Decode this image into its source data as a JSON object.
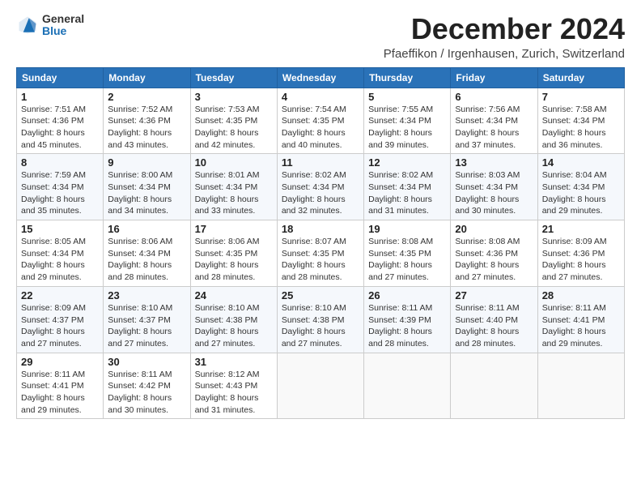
{
  "logo": {
    "general": "General",
    "blue": "Blue"
  },
  "title": "December 2024",
  "location": "Pfaeffikon / Irgenhausen, Zurich, Switzerland",
  "headers": [
    "Sunday",
    "Monday",
    "Tuesday",
    "Wednesday",
    "Thursday",
    "Friday",
    "Saturday"
  ],
  "weeks": [
    [
      {
        "day": "1",
        "info": "Sunrise: 7:51 AM\nSunset: 4:36 PM\nDaylight: 8 hours\nand 45 minutes."
      },
      {
        "day": "2",
        "info": "Sunrise: 7:52 AM\nSunset: 4:36 PM\nDaylight: 8 hours\nand 43 minutes."
      },
      {
        "day": "3",
        "info": "Sunrise: 7:53 AM\nSunset: 4:35 PM\nDaylight: 8 hours\nand 42 minutes."
      },
      {
        "day": "4",
        "info": "Sunrise: 7:54 AM\nSunset: 4:35 PM\nDaylight: 8 hours\nand 40 minutes."
      },
      {
        "day": "5",
        "info": "Sunrise: 7:55 AM\nSunset: 4:34 PM\nDaylight: 8 hours\nand 39 minutes."
      },
      {
        "day": "6",
        "info": "Sunrise: 7:56 AM\nSunset: 4:34 PM\nDaylight: 8 hours\nand 37 minutes."
      },
      {
        "day": "7",
        "info": "Sunrise: 7:58 AM\nSunset: 4:34 PM\nDaylight: 8 hours\nand 36 minutes."
      }
    ],
    [
      {
        "day": "8",
        "info": "Sunrise: 7:59 AM\nSunset: 4:34 PM\nDaylight: 8 hours\nand 35 minutes."
      },
      {
        "day": "9",
        "info": "Sunrise: 8:00 AM\nSunset: 4:34 PM\nDaylight: 8 hours\nand 34 minutes."
      },
      {
        "day": "10",
        "info": "Sunrise: 8:01 AM\nSunset: 4:34 PM\nDaylight: 8 hours\nand 33 minutes."
      },
      {
        "day": "11",
        "info": "Sunrise: 8:02 AM\nSunset: 4:34 PM\nDaylight: 8 hours\nand 32 minutes."
      },
      {
        "day": "12",
        "info": "Sunrise: 8:02 AM\nSunset: 4:34 PM\nDaylight: 8 hours\nand 31 minutes."
      },
      {
        "day": "13",
        "info": "Sunrise: 8:03 AM\nSunset: 4:34 PM\nDaylight: 8 hours\nand 30 minutes."
      },
      {
        "day": "14",
        "info": "Sunrise: 8:04 AM\nSunset: 4:34 PM\nDaylight: 8 hours\nand 29 minutes."
      }
    ],
    [
      {
        "day": "15",
        "info": "Sunrise: 8:05 AM\nSunset: 4:34 PM\nDaylight: 8 hours\nand 29 minutes."
      },
      {
        "day": "16",
        "info": "Sunrise: 8:06 AM\nSunset: 4:34 PM\nDaylight: 8 hours\nand 28 minutes."
      },
      {
        "day": "17",
        "info": "Sunrise: 8:06 AM\nSunset: 4:35 PM\nDaylight: 8 hours\nand 28 minutes."
      },
      {
        "day": "18",
        "info": "Sunrise: 8:07 AM\nSunset: 4:35 PM\nDaylight: 8 hours\nand 28 minutes."
      },
      {
        "day": "19",
        "info": "Sunrise: 8:08 AM\nSunset: 4:35 PM\nDaylight: 8 hours\nand 27 minutes."
      },
      {
        "day": "20",
        "info": "Sunrise: 8:08 AM\nSunset: 4:36 PM\nDaylight: 8 hours\nand 27 minutes."
      },
      {
        "day": "21",
        "info": "Sunrise: 8:09 AM\nSunset: 4:36 PM\nDaylight: 8 hours\nand 27 minutes."
      }
    ],
    [
      {
        "day": "22",
        "info": "Sunrise: 8:09 AM\nSunset: 4:37 PM\nDaylight: 8 hours\nand 27 minutes."
      },
      {
        "day": "23",
        "info": "Sunrise: 8:10 AM\nSunset: 4:37 PM\nDaylight: 8 hours\nand 27 minutes."
      },
      {
        "day": "24",
        "info": "Sunrise: 8:10 AM\nSunset: 4:38 PM\nDaylight: 8 hours\nand 27 minutes."
      },
      {
        "day": "25",
        "info": "Sunrise: 8:10 AM\nSunset: 4:38 PM\nDaylight: 8 hours\nand 27 minutes."
      },
      {
        "day": "26",
        "info": "Sunrise: 8:11 AM\nSunset: 4:39 PM\nDaylight: 8 hours\nand 28 minutes."
      },
      {
        "day": "27",
        "info": "Sunrise: 8:11 AM\nSunset: 4:40 PM\nDaylight: 8 hours\nand 28 minutes."
      },
      {
        "day": "28",
        "info": "Sunrise: 8:11 AM\nSunset: 4:41 PM\nDaylight: 8 hours\nand 29 minutes."
      }
    ],
    [
      {
        "day": "29",
        "info": "Sunrise: 8:11 AM\nSunset: 4:41 PM\nDaylight: 8 hours\nand 29 minutes."
      },
      {
        "day": "30",
        "info": "Sunrise: 8:11 AM\nSunset: 4:42 PM\nDaylight: 8 hours\nand 30 minutes."
      },
      {
        "day": "31",
        "info": "Sunrise: 8:12 AM\nSunset: 4:43 PM\nDaylight: 8 hours\nand 31 minutes."
      },
      {
        "day": "",
        "info": ""
      },
      {
        "day": "",
        "info": ""
      },
      {
        "day": "",
        "info": ""
      },
      {
        "day": "",
        "info": ""
      }
    ]
  ]
}
